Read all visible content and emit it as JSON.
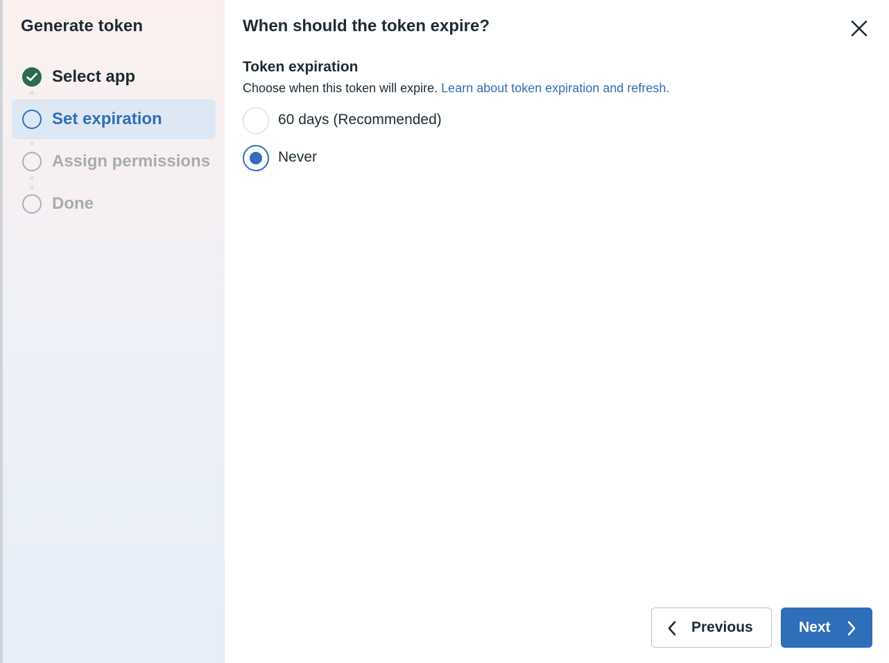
{
  "sidebar": {
    "title": "Generate token",
    "steps": [
      {
        "label": "Select app",
        "state": "done",
        "icon": "check-circle-icon"
      },
      {
        "label": "Set expiration",
        "state": "current",
        "icon": "circle-outline-icon"
      },
      {
        "label": "Assign permissions",
        "state": "pending",
        "icon": "circle-outline-icon"
      },
      {
        "label": "Done",
        "state": "pending",
        "icon": "circle-outline-icon"
      }
    ]
  },
  "main": {
    "title": "When should the token expire?",
    "close_icon": "close-icon",
    "section": {
      "title": "Token expiration",
      "description": "Choose when this token will expire.",
      "link": "Learn about token expiration and refresh."
    },
    "options": [
      {
        "label": "60 days (Recommended)",
        "selected": false
      },
      {
        "label": "Never",
        "selected": true
      }
    ]
  },
  "footer": {
    "previous_label": "Previous",
    "next_label": "Next",
    "previous_icon": "chevron-left-icon",
    "next_icon": "chevron-right-icon"
  },
  "colors": {
    "accent": "#2f6eb8",
    "done": "#2b6b4f",
    "text": "#1c2b33",
    "muted": "#a7abb0"
  }
}
